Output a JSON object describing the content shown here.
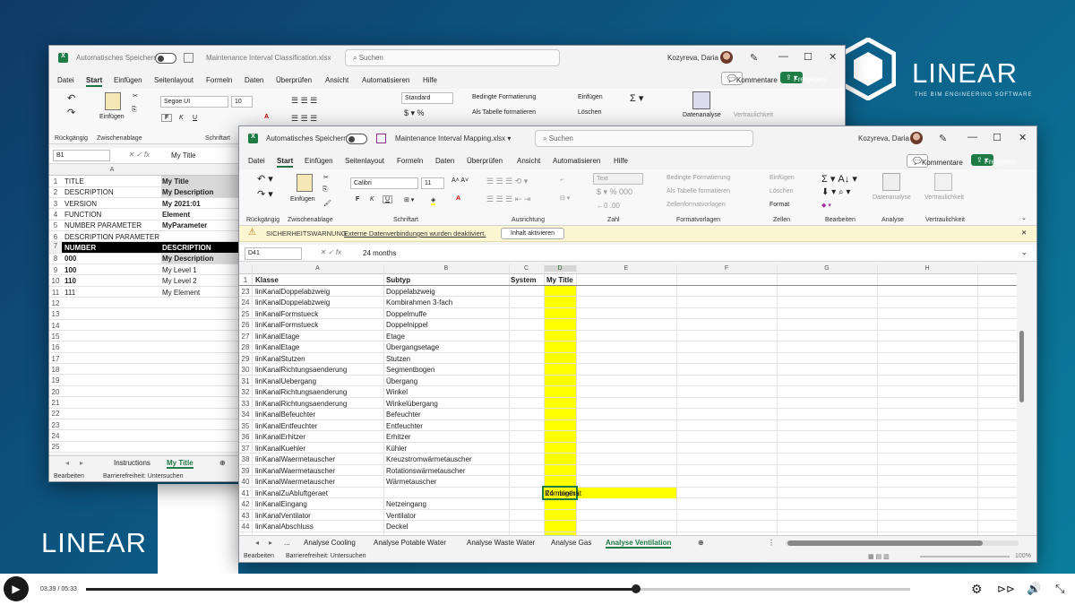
{
  "branding": {
    "logo_top": "LINEAR",
    "tagline": "THE BIM ENGINEERING SOFTWARE",
    "logo_bottom": "LINEAR"
  },
  "back": {
    "autosave": "Automatisches Speichern",
    "filename": "Maintenance Interval Classification.xlsx",
    "search": "Suchen",
    "user": "Kozyreva, Daria",
    "menu": [
      "Datei",
      "Start",
      "Einfügen",
      "Seitenlayout",
      "Formeln",
      "Daten",
      "Überprüfen",
      "Ansicht",
      "Automatisieren",
      "Hilfe"
    ],
    "comment_btn": "Kommentare",
    "share_btn": "Freigeben",
    "ribbon": {
      "font": "Segoe UI",
      "size": "10",
      "numfmt": "Standard",
      "paste": "Einfügen",
      "cond": "Bedingte Formatierung",
      "astable": "Als Tabelle formatieren",
      "insert": "Einfügen",
      "delete": "Löschen",
      "analyse": "Datenanalyse",
      "conf": "Vertraulichkeit",
      "g_undo": "Rückgängig",
      "g_clip": "Zwischenablage",
      "g_font": "Schriftart"
    },
    "namebox": "B1",
    "formula": "My Title",
    "col_a": "A",
    "rows": [
      {
        "n": "1",
        "a": "TITLE",
        "b": "My Title",
        "style": "sel"
      },
      {
        "n": "2",
        "a": "DESCRIPTION",
        "b": "My Description",
        "style": "sel"
      },
      {
        "n": "3",
        "a": "VERSION",
        "b": "My 2021:01",
        "style": "bold"
      },
      {
        "n": "4",
        "a": "FUNCTION",
        "b": "Element",
        "style": "bold"
      },
      {
        "n": "5",
        "a": "NUMBER PARAMETER",
        "b": "MyParameter",
        "style": "bold"
      },
      {
        "n": "6",
        "a": "DESCRIPTION PARAMETER",
        "b": "",
        "style": ""
      },
      {
        "n": "7",
        "a": "NUMBER",
        "b": "DESCRIPTION",
        "style": "black"
      },
      {
        "n": "8",
        "a": "000",
        "b": "My Description",
        "style": "sel"
      },
      {
        "n": "9",
        "a": "100",
        "b": "My Level 1",
        "style": "bolda"
      },
      {
        "n": "10",
        "a": "110",
        "b": "My Level 2",
        "style": "bolda"
      },
      {
        "n": "11",
        "a": "111",
        "b": "My Element",
        "style": ""
      },
      {
        "n": "12",
        "a": "",
        "b": "",
        "style": ""
      },
      {
        "n": "13",
        "a": "",
        "b": "",
        "style": ""
      },
      {
        "n": "14",
        "a": "",
        "b": "",
        "style": ""
      },
      {
        "n": "15",
        "a": "",
        "b": "",
        "style": ""
      },
      {
        "n": "16",
        "a": "",
        "b": "",
        "style": ""
      },
      {
        "n": "17",
        "a": "",
        "b": "",
        "style": ""
      },
      {
        "n": "18",
        "a": "",
        "b": "",
        "style": ""
      },
      {
        "n": "19",
        "a": "",
        "b": "",
        "style": ""
      },
      {
        "n": "20",
        "a": "",
        "b": "",
        "style": ""
      },
      {
        "n": "21",
        "a": "",
        "b": "",
        "style": ""
      },
      {
        "n": "22",
        "a": "",
        "b": "",
        "style": ""
      },
      {
        "n": "23",
        "a": "",
        "b": "",
        "style": ""
      },
      {
        "n": "24",
        "a": "",
        "b": "",
        "style": ""
      },
      {
        "n": "25",
        "a": "",
        "b": "",
        "style": ""
      }
    ],
    "tabs": [
      "Instructions",
      "My Title"
    ],
    "status": "Bearbeiten",
    "access": "Barrierefreiheit: Untersuchen"
  },
  "front": {
    "autosave": "Automatisches Speichern",
    "filename": "Maintenance Interval Mapping.xlsx",
    "search": "Suchen",
    "user": "Kozyreva, Daria",
    "menu": [
      "Datei",
      "Start",
      "Einfügen",
      "Seitenlayout",
      "Formeln",
      "Daten",
      "Überprüfen",
      "Ansicht",
      "Automatisieren",
      "Hilfe"
    ],
    "comment_btn": "Kommentare",
    "share_btn": "Freigeben",
    "ribbon": {
      "font": "Calibri",
      "size": "11",
      "numfmt": "Text",
      "paste": "Einfügen",
      "cond": "Bedingte Formatierung",
      "astable": "Als Tabelle formatieren",
      "cellfmt": "Zellenformatvorlagen",
      "insert": "Einfügen",
      "delete": "Löschen",
      "format": "Format",
      "analyse": "Datenanalyse",
      "conf": "Vertraulichkeit",
      "groups": [
        "Rückgängig",
        "Zwischenablage",
        "Schriftart",
        "Ausrichtung",
        "Zahl",
        "Formatvorlagen",
        "Zellen",
        "Bearbeiten",
        "Analyse",
        "Vertraulichkeit"
      ]
    },
    "warning": {
      "title": "SICHERHEITSWARNUNG",
      "text": "Externe Datenverbindungen wurden deaktiviert.",
      "button": "Inhalt aktivieren"
    },
    "namebox": "D41",
    "formula": "24 months",
    "cols": [
      "A",
      "B",
      "C",
      "D",
      "E",
      "F",
      "G",
      "H"
    ],
    "header": {
      "n": "1",
      "a": "Klasse",
      "b": "Subtyp",
      "c": "System",
      "d": "My Title"
    },
    "rows": [
      {
        "n": "23",
        "a": "linKanalDoppelabzweig",
        "b": "Doppelabzweig",
        "d": ""
      },
      {
        "n": "24",
        "a": "linKanalDoppelabzweig",
        "b": "Kombirahmen 3-fach",
        "d": ""
      },
      {
        "n": "25",
        "a": "linKanalFormstueck",
        "b": "Doppelmuffe",
        "d": ""
      },
      {
        "n": "26",
        "a": "linKanalFormstueck",
        "b": "Doppelnippel",
        "d": ""
      },
      {
        "n": "27",
        "a": "linKanalEtage",
        "b": "Etage",
        "d": ""
      },
      {
        "n": "28",
        "a": "linKanalEtage",
        "b": "Übergangsetage",
        "d": ""
      },
      {
        "n": "29",
        "a": "linKanalStutzen",
        "b": "Stutzen",
        "d": ""
      },
      {
        "n": "30",
        "a": "linKanalRichtungsaenderung",
        "b": "Segmentbogen",
        "d": ""
      },
      {
        "n": "31",
        "a": "linKanalUebergang",
        "b": "Übergang",
        "d": ""
      },
      {
        "n": "32",
        "a": "linKanalRichtungsaenderung",
        "b": "Winkel",
        "d": ""
      },
      {
        "n": "33",
        "a": "linKanalRichtungsaenderung",
        "b": "Winkelübergang",
        "d": ""
      },
      {
        "n": "34",
        "a": "linKanalBefeuchter",
        "b": "Befeuchter",
        "d": ""
      },
      {
        "n": "35",
        "a": "linKanalEntfeuchter",
        "b": "Entfeuchter",
        "d": ""
      },
      {
        "n": "36",
        "a": "linKanalErhitzer",
        "b": "Erhitzer",
        "d": ""
      },
      {
        "n": "37",
        "a": "linKanalKuehler",
        "b": "Kühler",
        "d": ""
      },
      {
        "n": "38",
        "a": "linKanalWaermetauscher",
        "b": "Kreuzstromwärmetauscher",
        "d": ""
      },
      {
        "n": "39",
        "a": "linKanalWaermetauscher",
        "b": "Rotationswärmetauscher",
        "d": ""
      },
      {
        "n": "40",
        "a": "linKanalWaermetauscher",
        "b": "Wärmetauscher",
        "d": ""
      },
      {
        "n": "41",
        "a": "linKanalZuAbluftgeraet",
        "b": "Kombigerät",
        "d": "24 months"
      },
      {
        "n": "42",
        "a": "linKanalEingang",
        "b": "Netzeingang",
        "d": ""
      },
      {
        "n": "43",
        "a": "linKanalVentilator",
        "b": "Ventilator",
        "d": ""
      },
      {
        "n": "44",
        "a": "linKanalAbschluss",
        "b": "Deckel",
        "d": ""
      }
    ],
    "tabs": [
      "...",
      "Analyse Cooling",
      "Analyse Potable Water",
      "Analyse Waste Water",
      "Analyse Gas",
      "Analyse Ventilation"
    ],
    "status": "Bearbeiten",
    "access": "Barrierefreiheit: Untersuchen",
    "zoom": "100%"
  },
  "player": {
    "time": "03:39 / 05:33",
    "progress": 0.667
  }
}
